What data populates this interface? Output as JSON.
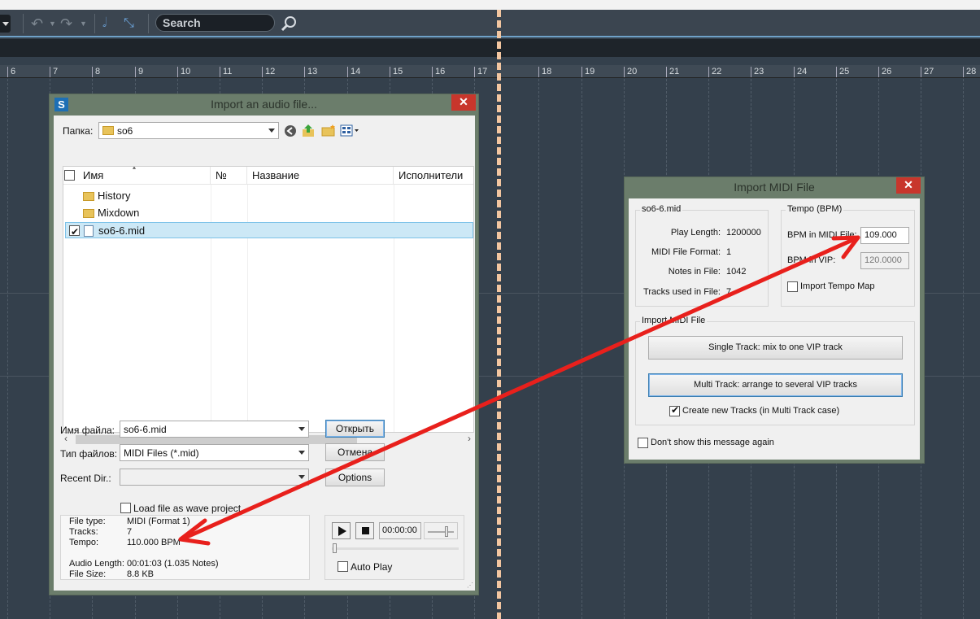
{
  "toolbar": {
    "search_placeholder": "Search"
  },
  "ruler": [
    "6",
    "7",
    "8",
    "9",
    "10",
    "11",
    "12",
    "13",
    "14",
    "15",
    "16",
    "17",
    "18",
    "19",
    "20",
    "21",
    "22",
    "23",
    "24",
    "25",
    "26",
    "27",
    "28"
  ],
  "import_audio": {
    "title": "Import an audio file...",
    "folder_label": "Папка:",
    "folder_value": "so6",
    "columns": [
      "Имя",
      "№",
      "Название",
      "Исполнители"
    ],
    "items": [
      {
        "name": "History",
        "type": "folder"
      },
      {
        "name": "Mixdown",
        "type": "folder"
      },
      {
        "name": "so6-6.mid",
        "type": "file",
        "selected": true
      }
    ],
    "filename_label": "Имя файла:",
    "filename_value": "so6-6.mid",
    "filetype_label": "Тип файлов:",
    "filetype_value": "MIDI Files (*.mid)",
    "recent_label": "Recent Dir.:",
    "open_button": "Открыть",
    "cancel_button": "Отмена",
    "options_button": "Options",
    "load_wave_label": "Load file as wave project",
    "info": {
      "file_type_label": "File type:",
      "file_type_value": "MIDI  (Format 1)",
      "tracks_label": "Tracks:",
      "tracks_value": "7",
      "tempo_label": "Tempo:",
      "tempo_value": "110.000 BPM",
      "audio_length_label": "Audio Length:",
      "audio_length_value": "00:01:03  (1.035 Notes)",
      "file_size_label": "File Size:",
      "file_size_value": "8.8 KB"
    },
    "time_display": "00:00:00",
    "auto_play_label": "Auto Play"
  },
  "import_midi": {
    "title": "Import MIDI File",
    "file_group": "so6-6.mid",
    "play_length_label": "Play Length:",
    "play_length_value": "1200000",
    "format_label": "MIDI File Format:",
    "format_value": "1",
    "notes_label": "Notes in File:",
    "notes_value": "1042",
    "tracks_label": "Tracks used in File:",
    "tracks_value": "7",
    "tempo_group": "Tempo (BPM)",
    "bpm_midi_label": "BPM in MIDI File:",
    "bpm_midi_value": "109.000",
    "bpm_vip_label": "BPM in VIP:",
    "bpm_vip_value": "120.0000",
    "tempo_map_label": "Import Tempo Map",
    "import_group": "Import MIDI File",
    "single_track_button": "Single Track: mix to one VIP track",
    "multi_track_button": "Multi Track: arrange to several VIP tracks",
    "create_tracks_label": "Create new Tracks (in Multi Track case)",
    "dont_show_label": "Don't show this message again"
  },
  "colors": {
    "arrow": "#e8201c",
    "close": "#c8362c",
    "accent": "#6fa1c8"
  }
}
